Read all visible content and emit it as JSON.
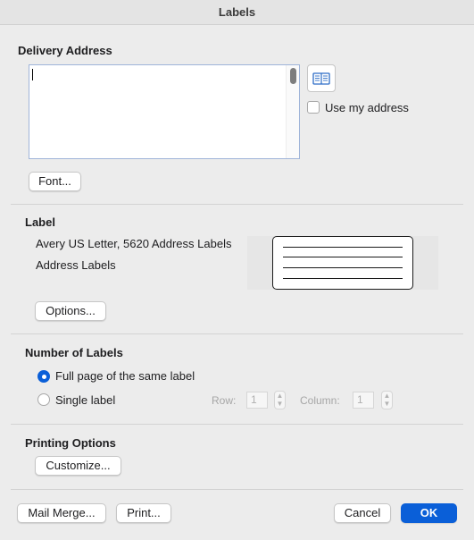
{
  "window": {
    "title": "Labels"
  },
  "delivery_address": {
    "title": "Delivery Address",
    "value": "",
    "use_my_address_label": "Use my address",
    "use_my_address_checked": false,
    "font_button": "Font..."
  },
  "label": {
    "title": "Label",
    "product": "Avery US Letter, 5620 Address Labels",
    "type": "Address Labels",
    "options_button": "Options..."
  },
  "number_of_labels": {
    "title": "Number of Labels",
    "full_page_label": "Full page of the same label",
    "single_label_label": "Single label",
    "selected": "full_page",
    "row_label": "Row:",
    "row_value": "1",
    "column_label": "Column:",
    "column_value": "1"
  },
  "printing_options": {
    "title": "Printing Options",
    "customize_button": "Customize..."
  },
  "footer": {
    "mail_merge_button": "Mail Merge...",
    "print_button": "Print...",
    "cancel_button": "Cancel",
    "ok_button": "OK"
  },
  "icons": {
    "address_book": "address-book-icon",
    "stepper_up": "▲",
    "stepper_down": "▼"
  },
  "colors": {
    "accent": "#0a5fd8",
    "window_bg": "#ececec"
  }
}
